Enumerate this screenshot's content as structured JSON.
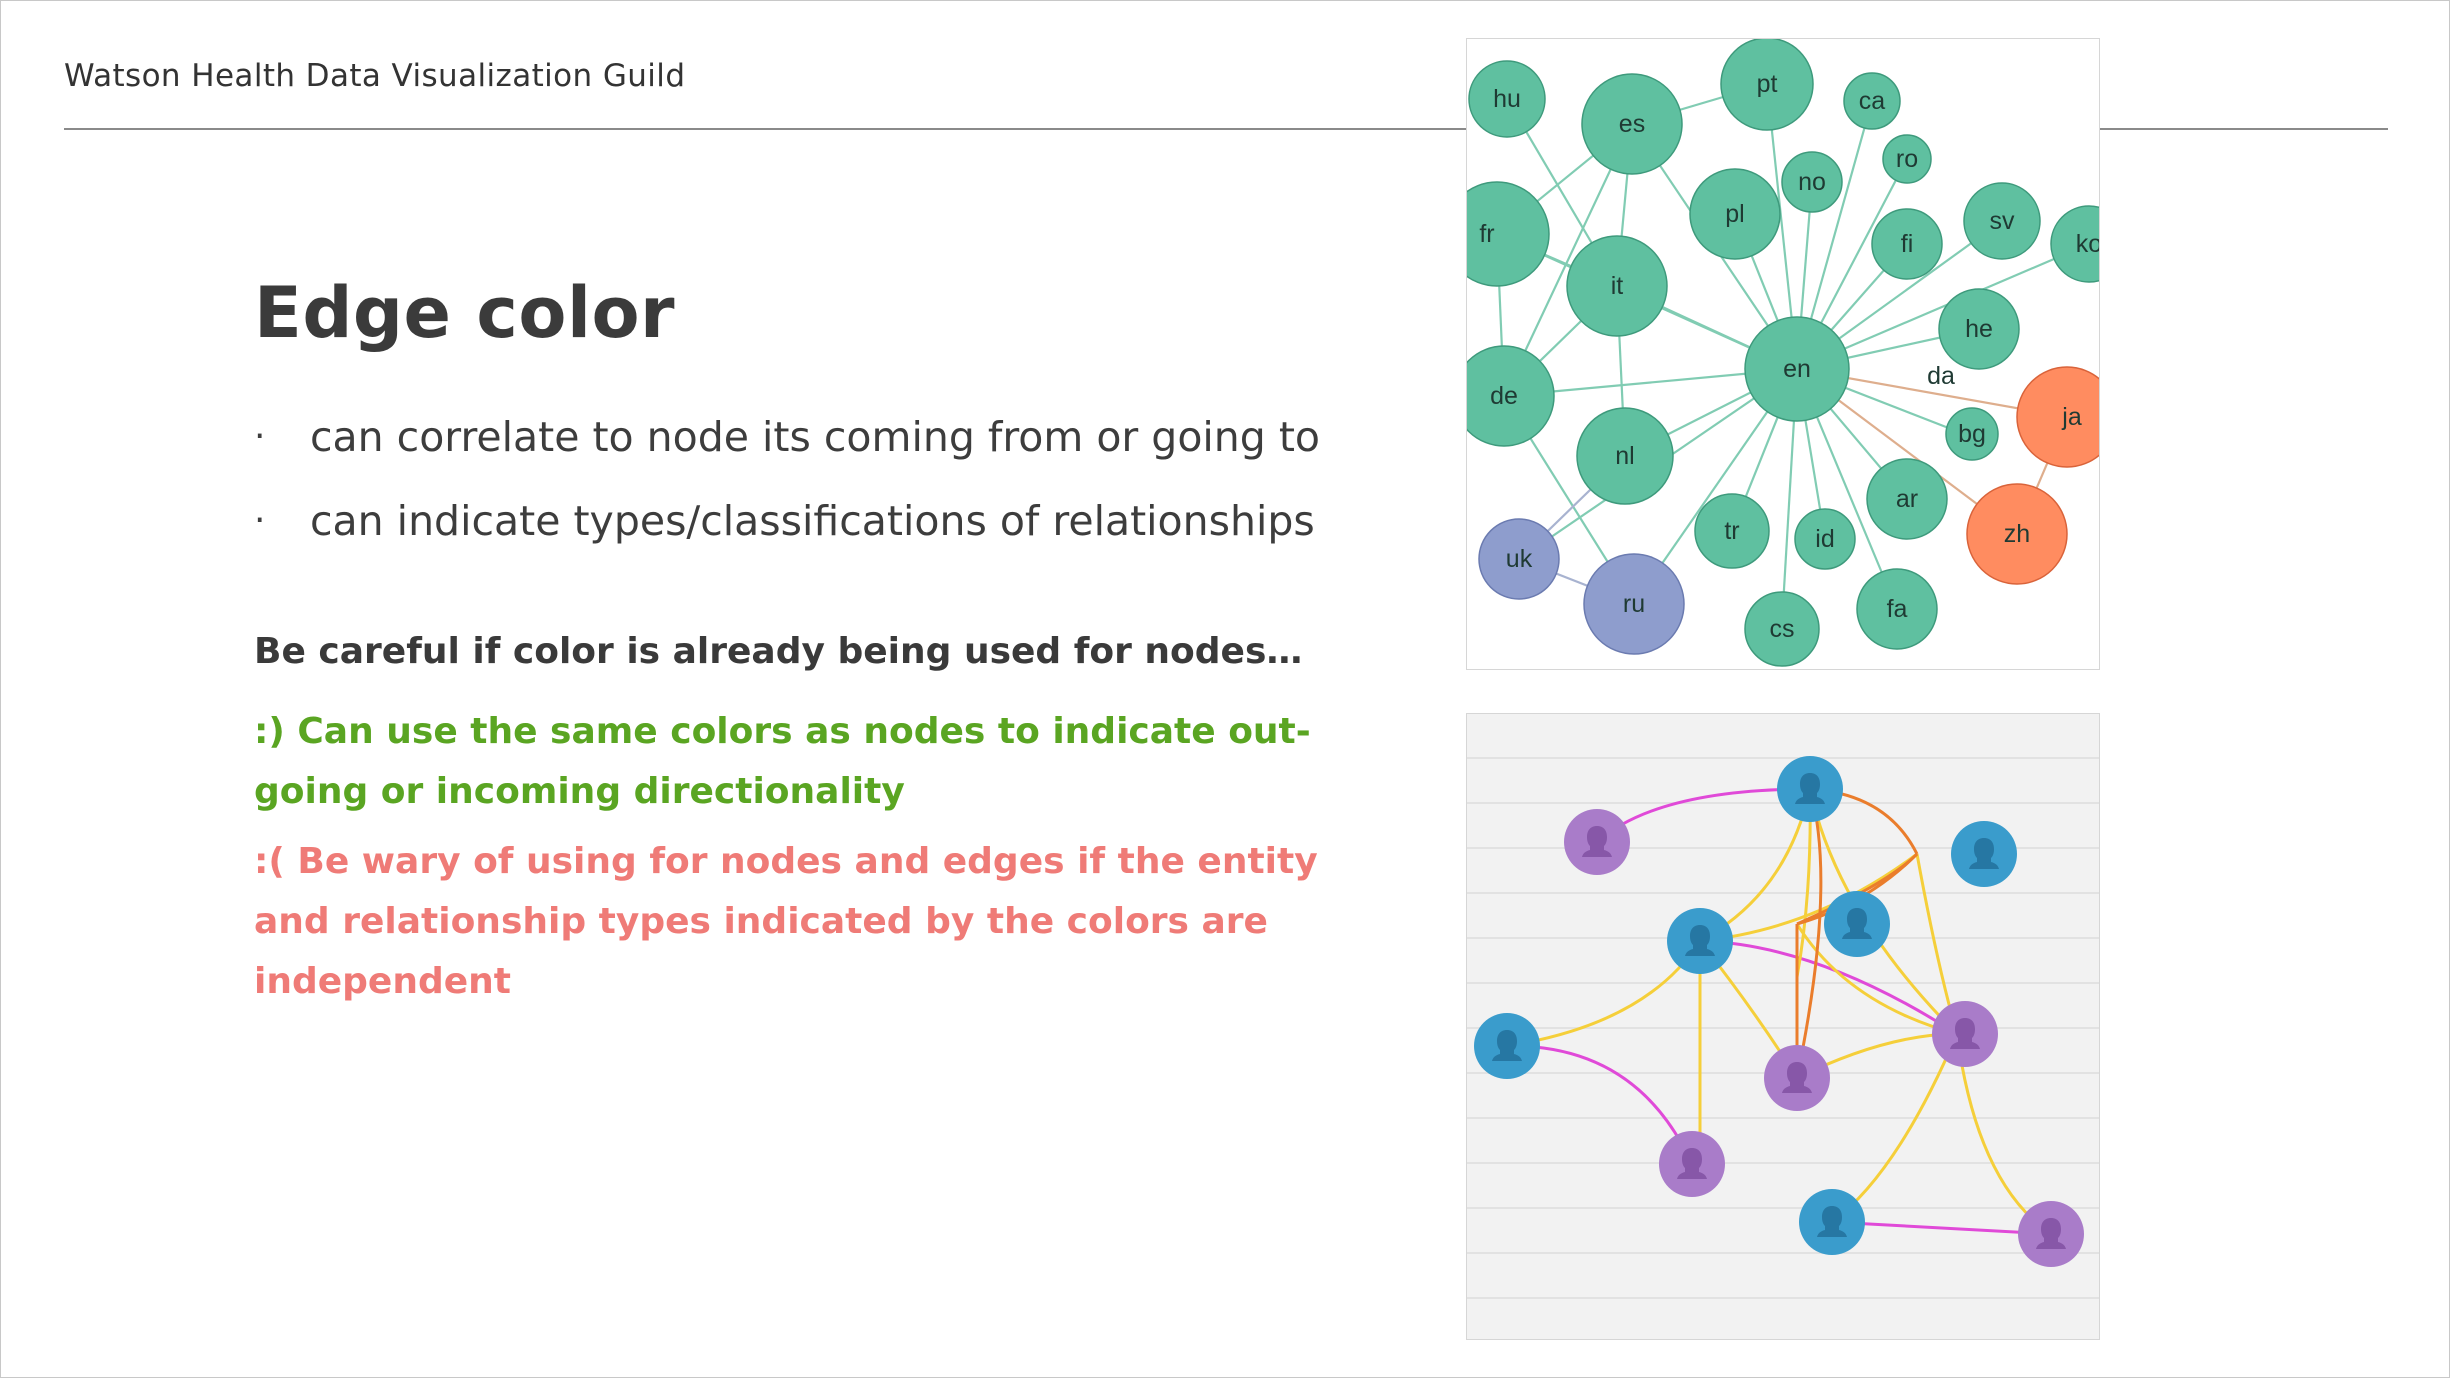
{
  "header": {
    "guild": "Watson Health Data Visualization Guild"
  },
  "slide": {
    "title": "Edge color",
    "bullets": [
      "can correlate to node its coming from or going to",
      "can indicate types/classifications of relationships"
    ],
    "bullet_marker": "·",
    "notes": {
      "careful": "Be careful if color is already being used for nodes…",
      "good": ":) Can use the same colors as nodes to indicate out-going or incoming directionality",
      "bad": ":( Be wary of using for nodes and edges if the entity and relationship types indicated by the colors are independent"
    }
  },
  "colors": {
    "green_node": "#5fc0a0",
    "orange_node": "#ff8c60",
    "purple_node": "#8e9dcd",
    "edge_green": "#6cc4a6",
    "edge_orange": "#d9a07a",
    "person_blue": "#3a9ccc",
    "person_purple": "#a97cc9",
    "edge_magenta": "#e04ad8",
    "edge_yellow": "#f5cf3a",
    "edge_dark_orange": "#ea7d2c"
  },
  "language_graph": {
    "nodes": [
      "hu",
      "es",
      "pt",
      "ca",
      "ro",
      "no",
      "pl",
      "fr",
      "it",
      "fi",
      "sv",
      "ko",
      "he",
      "en",
      "da",
      "de",
      "ja",
      "bg",
      "nl",
      "ar",
      "tr",
      "id",
      "zh",
      "uk",
      "ru",
      "cs",
      "fa"
    ]
  },
  "people_graph": {
    "person_icon": "person-icon",
    "node_count": 12
  }
}
